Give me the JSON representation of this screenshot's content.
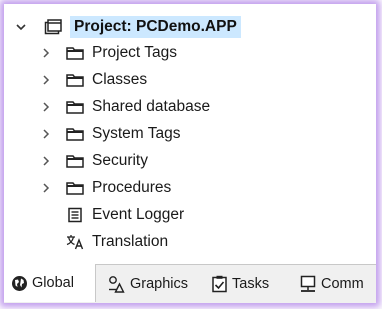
{
  "tree": {
    "root": {
      "label": "Project: PCDemo.APP",
      "expanded": true,
      "icon": "project-icon"
    },
    "items": [
      {
        "label": "Project Tags",
        "expandable": true,
        "icon": "folder-icon"
      },
      {
        "label": "Classes",
        "expandable": true,
        "icon": "folder-icon"
      },
      {
        "label": "Shared database",
        "expandable": true,
        "icon": "folder-icon"
      },
      {
        "label": "System Tags",
        "expandable": true,
        "icon": "folder-icon"
      },
      {
        "label": "Security",
        "expandable": true,
        "icon": "folder-icon"
      },
      {
        "label": "Procedures",
        "expandable": true,
        "icon": "folder-icon"
      },
      {
        "label": "Event Logger",
        "expandable": false,
        "icon": "event-logger-icon"
      },
      {
        "label": "Translation",
        "expandable": false,
        "icon": "translation-icon"
      }
    ]
  },
  "tabs": [
    {
      "label": "Global",
      "active": true,
      "icon": "global-icon"
    },
    {
      "label": "Graphics",
      "active": false,
      "icon": "graphics-icon"
    },
    {
      "label": "Tasks",
      "active": false,
      "icon": "tasks-icon"
    },
    {
      "label": "Comm",
      "active": false,
      "icon": "comm-icon"
    }
  ],
  "colors": {
    "selection": "#cce8ff",
    "frame_glow": "#aa78e6"
  }
}
